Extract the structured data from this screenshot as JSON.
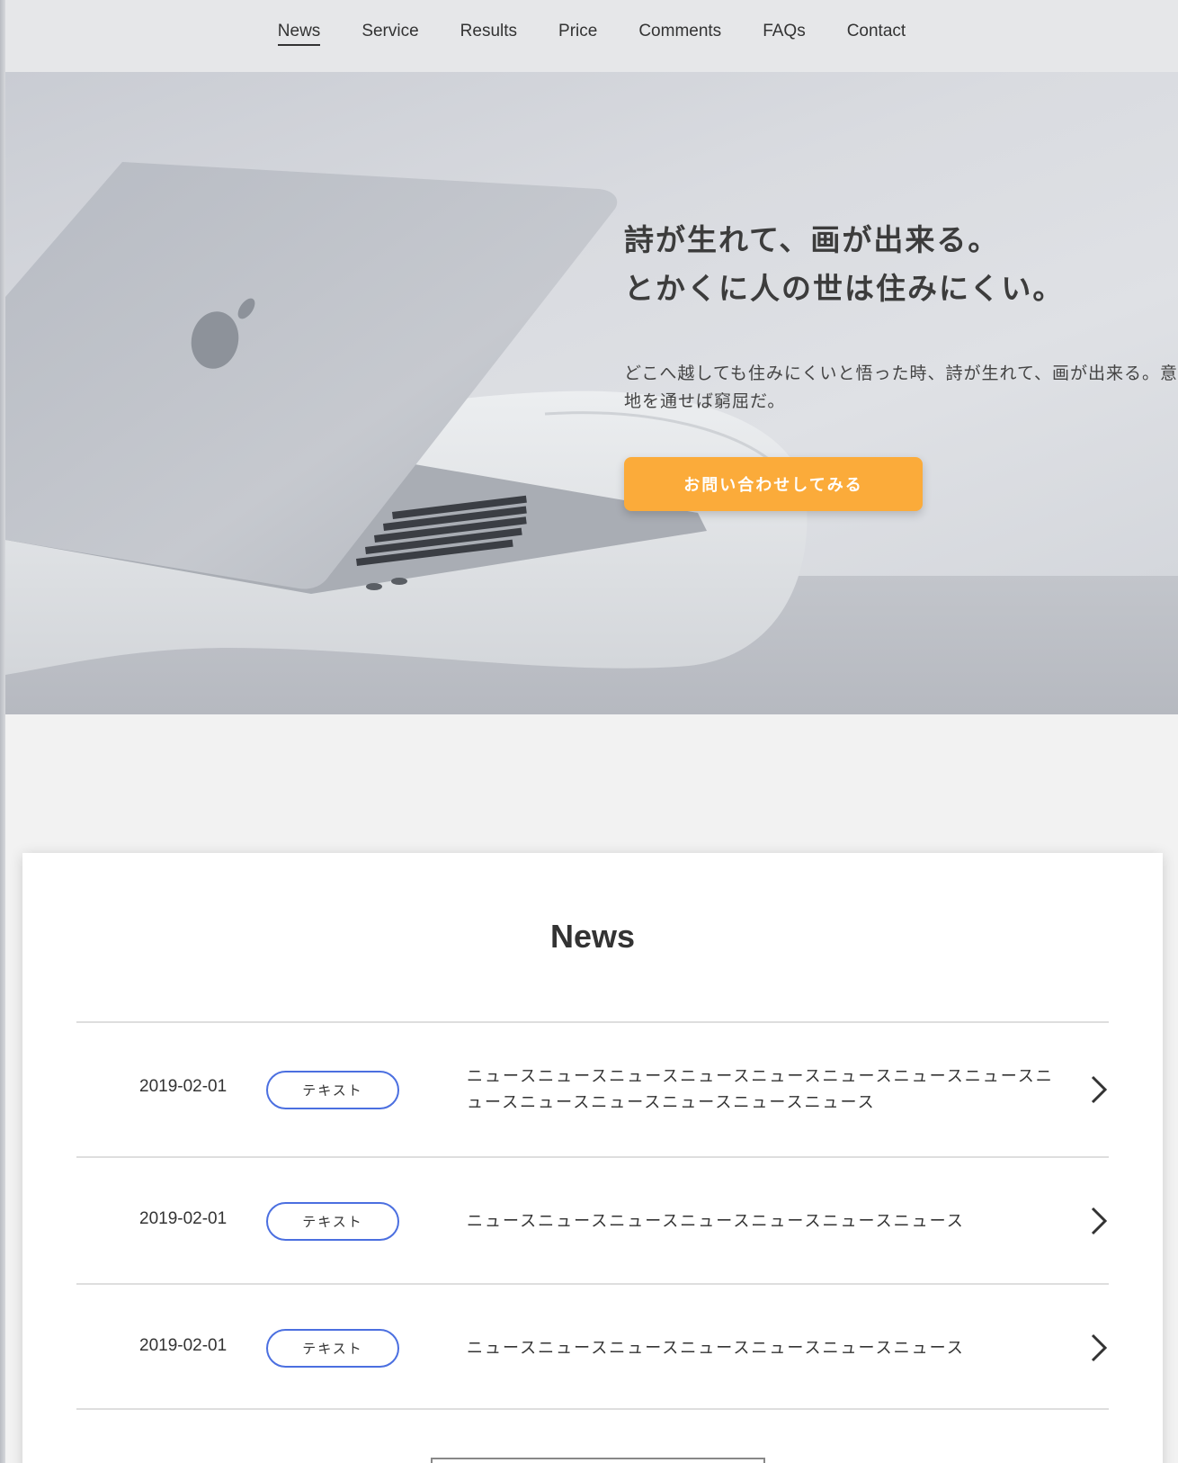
{
  "nav": {
    "items": [
      {
        "label": "News",
        "active": true
      },
      {
        "label": "Service"
      },
      {
        "label": "Results"
      },
      {
        "label": "Price"
      },
      {
        "label": "Comments"
      },
      {
        "label": "FAQs"
      },
      {
        "label": "Contact"
      }
    ]
  },
  "hero": {
    "title_line1": "詩が生れて、画が出来る。",
    "title_line2": "とかくに人の世は住みにくい。",
    "lead": "どこへ越しても住みにくいと悟った時、詩が生れて、画が出来る。意地を通せば窮屈だ。",
    "cta_label": "お問い合わせしてみる",
    "cta_color": "#fbab3a"
  },
  "news": {
    "title": "News",
    "tag_border_color": "#4b6fe0",
    "items": [
      {
        "date": "2019-02-01",
        "tag": "テキスト",
        "text": "ニュースニュースニュースニュースニュースニュースニュースニュースニュースニュースニュースニュースニュースニュース"
      },
      {
        "date": "2019-02-01",
        "tag": "テキスト",
        "text": "ニュースニュースニュースニュースニュースニュースニュース"
      },
      {
        "date": "2019-02-01",
        "tag": "テキスト",
        "text": "ニュースニュースニュースニュースニュースニュースニュース"
      }
    ]
  }
}
